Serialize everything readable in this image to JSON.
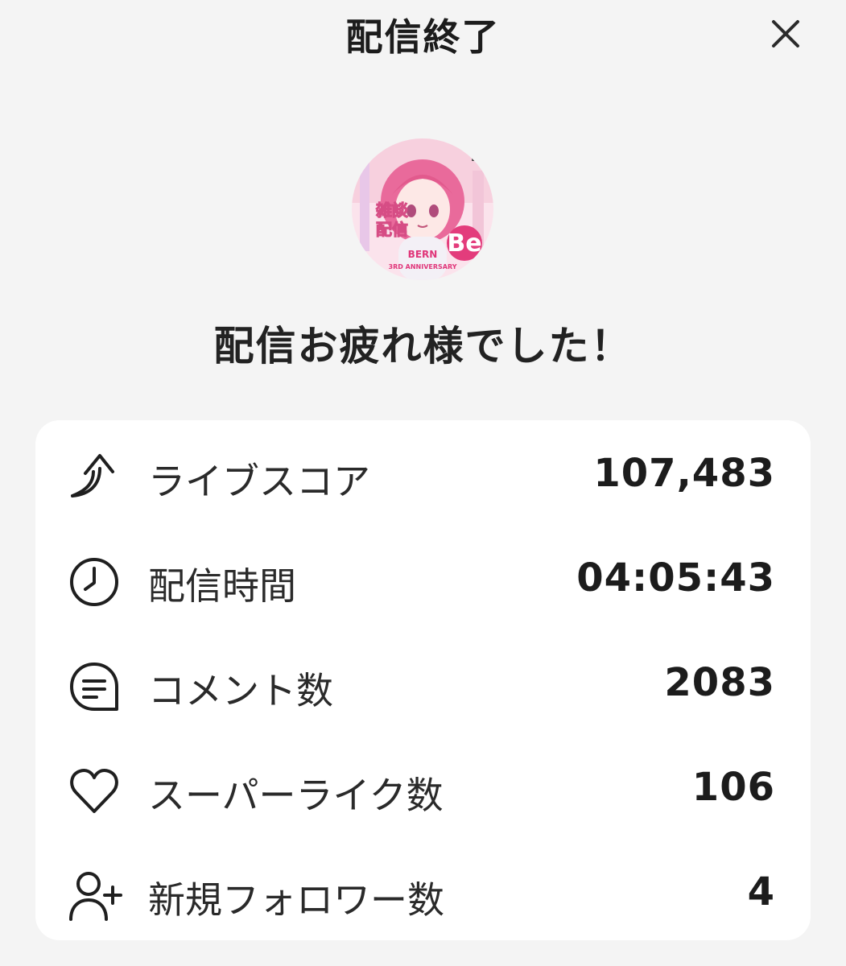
{
  "header": {
    "title": "配信終了",
    "close_icon": "close-icon"
  },
  "avatar": {
    "icon": "stream-thumbnail-avatar",
    "text_lines": [
      "雑談",
      "配信",
      "BERN",
      "3RD ANNIVERSARY",
      "Be"
    ]
  },
  "message": "配信お疲れ様でした！",
  "stats": [
    {
      "icon": "trend-up-arrow-icon",
      "label": "ライブスコア",
      "value": "107,483"
    },
    {
      "icon": "clock-icon",
      "label": "配信時間",
      "value": "04:05:43"
    },
    {
      "icon": "comment-icon",
      "label": "コメント数",
      "value": "2083"
    },
    {
      "icon": "heart-icon",
      "label": "スーパーライク数",
      "value": "106"
    },
    {
      "icon": "add-user-icon",
      "label": "新規フォロワー数",
      "value": "4"
    }
  ],
  "colors": {
    "background": "#f4f4f4",
    "card": "#ffffff",
    "text": "#1c1c1c",
    "avatar_accent": "#f06fa0"
  }
}
